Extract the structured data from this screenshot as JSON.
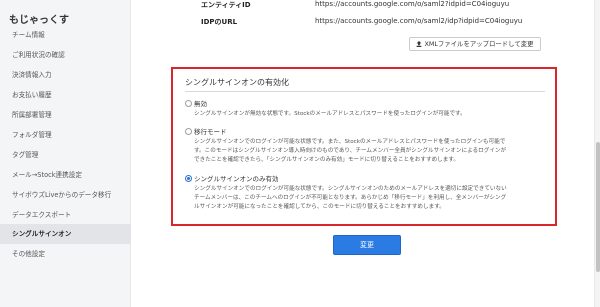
{
  "sidebar": {
    "title": "もじゃっくす",
    "items": [
      {
        "label": "チーム情報",
        "active": false
      },
      {
        "label": "ご利用状況の確認",
        "active": false
      },
      {
        "label": "決済情報入力",
        "active": false
      },
      {
        "label": "お支払い履歴",
        "active": false
      },
      {
        "label": "所属部署管理",
        "active": false
      },
      {
        "label": "フォルダ管理",
        "active": false
      },
      {
        "label": "タグ管理",
        "active": false
      },
      {
        "label": "メール→Stock連携設定",
        "active": false
      },
      {
        "label": "サイボウズLiveからのデータ移行",
        "active": false
      },
      {
        "label": "データエクスポート",
        "active": false
      },
      {
        "label": "シングルサインオン",
        "active": true
      },
      {
        "label": "その他設定",
        "active": false
      }
    ]
  },
  "idp": {
    "entity_label": "エンティティID",
    "entity_value": "https://accounts.google.com/o/saml2?idpid=C04ioguyu",
    "url_label": "IDPのURL",
    "url_value": "https://accounts.google.com/o/saml2/idp?idpid=C04ioguyu",
    "upload_button": "XMLファイルをアップロードして変更",
    "upload_icon": "upload-icon"
  },
  "sso": {
    "title": "シングルサインオンの有効化",
    "options": [
      {
        "label": "無効",
        "checked": false,
        "desc": [
          "シングルサインオンが無効な状態です。Stockのメールアドレスとパスワードを使ったログインが可能です。"
        ]
      },
      {
        "label": "移行モード",
        "checked": false,
        "desc": [
          "シングルサインオンでのログインが可能な状態です。また、Stockのメールアドレスとパスワードを使ったログインも可能で",
          "す。このモードはシングルサインオン導入時向けのものであり、チームメンバー全員がシングルサインオンによるログインが",
          "できたことを確認できたら、「シングルサインオンのみ有効」モードに切り替えることをおすすめします。"
        ]
      },
      {
        "label": "シングルサインオンのみ有効",
        "checked": true,
        "desc": [
          "シングルサインオンでのログインが可能な状態です。シングルサインオンのためのメールアドレスを適切に設定できていない",
          "チームメンバーは、このチームへのログインが不可能となります。あらかじめ「移行モード」を利用し、全メンバーがシング",
          "ルサインオンが可能になったことを確認してから、このモードに切り替えることをおすすめします。"
        ]
      }
    ],
    "save_button": "変更"
  },
  "colors": {
    "highlight_border": "#d9262d",
    "primary": "#2b7be5"
  }
}
